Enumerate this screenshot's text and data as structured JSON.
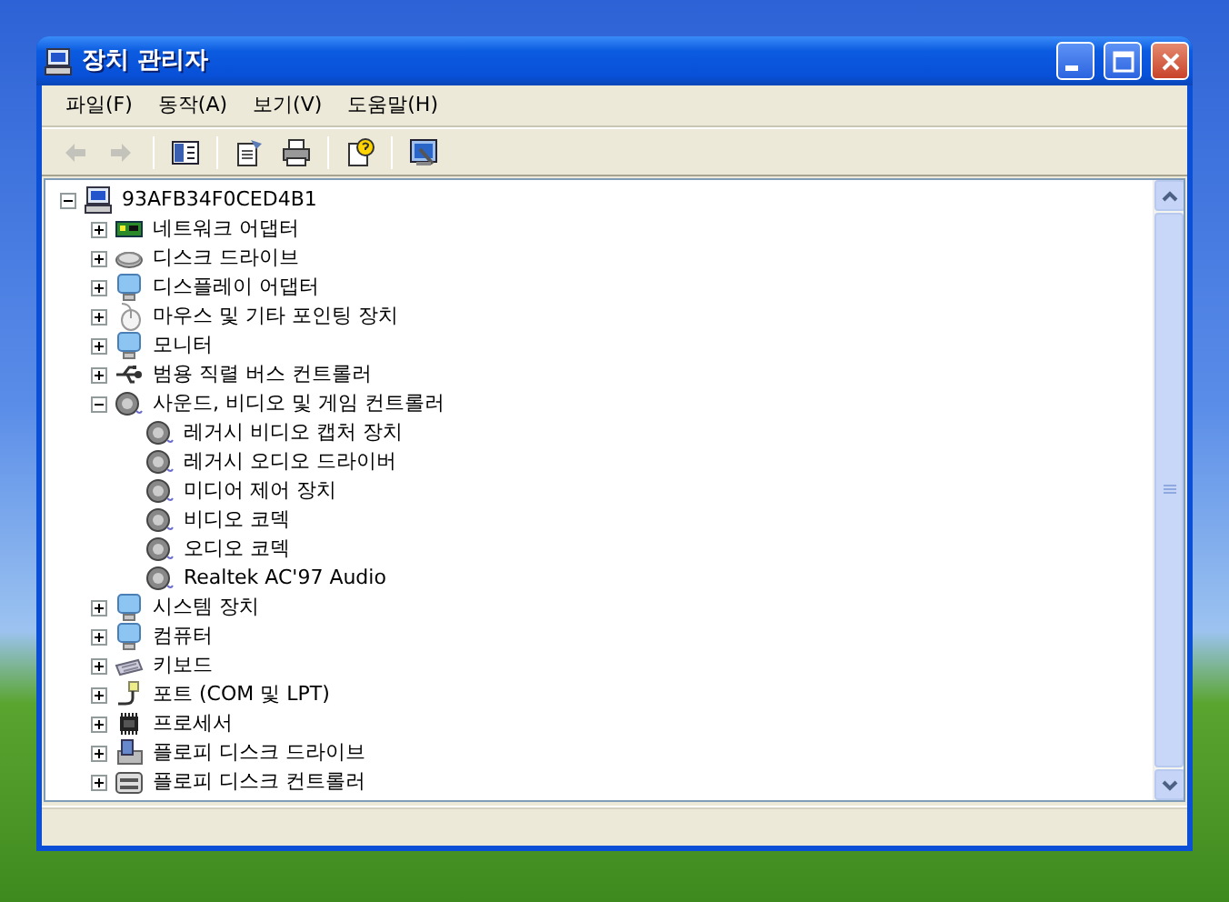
{
  "window": {
    "title": "장치 관리자"
  },
  "menu": [
    {
      "label": "파일(F)"
    },
    {
      "label": "동작(A)"
    },
    {
      "label": "보기(V)"
    },
    {
      "label": "도움말(H)"
    }
  ],
  "toolbar": [
    {
      "kind": "back",
      "disabled": true
    },
    {
      "kind": "forward",
      "disabled": true
    },
    {
      "kind": "sep"
    },
    {
      "kind": "tree",
      "disabled": false
    },
    {
      "kind": "sep"
    },
    {
      "kind": "properties",
      "disabled": false
    },
    {
      "kind": "print",
      "disabled": false
    },
    {
      "kind": "sep"
    },
    {
      "kind": "help",
      "disabled": false
    },
    {
      "kind": "sep"
    },
    {
      "kind": "scan",
      "disabled": false
    }
  ],
  "tree": {
    "label": "93AFB34F0CED4B1",
    "kind": "computer",
    "expanded": true,
    "children": [
      {
        "label": "네트워크 어댑터",
        "kind": "network",
        "expanded": false
      },
      {
        "label": "디스크 드라이브",
        "kind": "disk",
        "expanded": false
      },
      {
        "label": "디스플레이 어댑터",
        "kind": "display",
        "expanded": false
      },
      {
        "label": "마우스 및 기타 포인팅 장치",
        "kind": "mouse",
        "expanded": false
      },
      {
        "label": "모니터",
        "kind": "display",
        "expanded": false
      },
      {
        "label": "범용 직렬 버스 컨트롤러",
        "kind": "usb",
        "expanded": false
      },
      {
        "label": "사운드, 비디오 및 게임 컨트롤러",
        "kind": "sound",
        "expanded": true,
        "children": [
          {
            "label": "레거시 비디오 캡처 장치",
            "kind": "sound"
          },
          {
            "label": "레거시 오디오 드라이버",
            "kind": "sound"
          },
          {
            "label": "미디어 제어 장치",
            "kind": "sound"
          },
          {
            "label": "비디오 코덱",
            "kind": "sound"
          },
          {
            "label": "오디오 코덱",
            "kind": "sound"
          },
          {
            "label": "Realtek AC'97 Audio",
            "kind": "sound"
          }
        ]
      },
      {
        "label": "시스템 장치",
        "kind": "display",
        "expanded": false
      },
      {
        "label": "컴퓨터",
        "kind": "display",
        "expanded": false
      },
      {
        "label": "키보드",
        "kind": "keyboard",
        "expanded": false
      },
      {
        "label": "포트 (COM 및 LPT)",
        "kind": "port",
        "expanded": false
      },
      {
        "label": "프로세서",
        "kind": "cpu",
        "expanded": false
      },
      {
        "label": "플로피 디스크 드라이브",
        "kind": "floppy",
        "expanded": false
      },
      {
        "label": "플로피 디스크 컨트롤러",
        "kind": "floppyctl",
        "expanded": false
      }
    ]
  }
}
